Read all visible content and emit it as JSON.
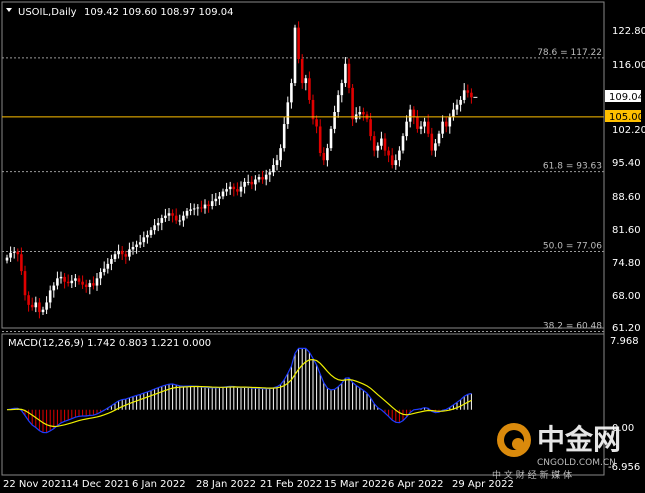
{
  "header": {
    "symbol": "USOIL,Daily",
    "ohlc": "109.42 109.60 108.97 109.04"
  },
  "macd_header": {
    "label": "MACD(12,26,9) 1.742 0.803 1.221 0.000"
  },
  "colors": {
    "background": "#000000",
    "bull": "#ffffff",
    "bear": "#e00000",
    "macd_line": "#1e3cff",
    "signal_line": "#f0f000",
    "fib_line": "#9a9a9a",
    "price_line": "#ffc000"
  },
  "watermark": {
    "brand": "中金网",
    "url": "CNGOLD.COM.CN",
    "slogan": "中 文 财 经 新 媒 体"
  },
  "chart_data": [
    {
      "type": "candlestick",
      "price_axis": {
        "ticks": [
          "122.80",
          "116.00",
          "109.04",
          "105.00",
          "102.20",
          "95.40",
          "88.60",
          "81.60",
          "74.80",
          "68.00",
          "61.20"
        ],
        "ylim": [
          60.5,
          126.5
        ]
      },
      "x_axis": {
        "labels": [
          "22 Nov 2021",
          "14 Dec 2021",
          "6 Jan 2022",
          "28 Jan 2022",
          "21 Feb 2022",
          "15 Mar 2022",
          "6 Apr 2022",
          "29 Apr 2022"
        ]
      },
      "current_price": "109.04",
      "horizontal_level": "105.00",
      "fib_levels": [
        {
          "label": "78.6 = 117.22",
          "value": 117.22
        },
        {
          "label": "61.8 = 93.63",
          "value": 93.63
        },
        {
          "label": "50.0 = 77.06",
          "value": 77.06
        },
        {
          "label": "38.2 = 60.48",
          "value": 60.48
        }
      ],
      "closes": [
        75.8,
        76.8,
        77.0,
        76.5,
        73.0,
        68.0,
        66.0,
        65.5,
        66.5,
        64.5,
        65.0,
        66.5,
        69.0,
        70.0,
        71.5,
        71.8,
        70.8,
        70.5,
        71.0,
        71.5,
        70.8,
        70.2,
        69.7,
        70.5,
        70.0,
        71.5,
        72.8,
        73.5,
        74.5,
        75.5,
        76.5,
        77.2,
        76.5,
        76.0,
        77.5,
        78.0,
        78.5,
        79.0,
        80.0,
        80.5,
        81.5,
        82.5,
        83.0,
        84.0,
        84.5,
        85.0,
        84.5,
        83.5,
        83.5,
        84.5,
        85.5,
        85.8,
        86.0,
        86.2,
        86.0,
        86.8,
        86.5,
        87.5,
        88.0,
        88.5,
        89.5,
        90.0,
        90.5,
        90.0,
        89.5,
        90.5,
        91.5,
        91.5,
        91.0,
        92.0,
        92.5,
        92.0,
        93.0,
        93.5,
        95.0,
        96.0,
        98.5,
        103.5,
        108.0,
        112.0,
        123.5,
        117.0,
        112.0,
        113.0,
        108.5,
        104.5,
        103.0,
        97.5,
        96.0,
        98.5,
        102.5,
        106.0,
        109.5,
        112.0,
        116.0,
        111.0,
        104.5,
        105.5,
        106.0,
        105.5,
        104.5,
        101.0,
        98.0,
        99.0,
        100.5,
        98.0,
        97.0,
        95.0,
        96.0,
        98.0,
        101.0,
        104.0,
        106.5,
        105.0,
        102.5,
        103.0,
        104.0,
        101.5,
        98.0,
        99.5,
        101.5,
        104.0,
        103.0,
        105.0,
        106.5,
        107.5,
        108.5,
        110.5,
        110.0,
        109.04
      ]
    },
    {
      "type": "macd",
      "params": "12,26,9",
      "values": {
        "macd": 1.742,
        "signal": 0.803,
        "histogram": 1.221
      },
      "axis_ticks": [
        "7.968",
        "0.00",
        "-6.956"
      ],
      "ylim": [
        -7.5,
        8.4
      ]
    }
  ]
}
